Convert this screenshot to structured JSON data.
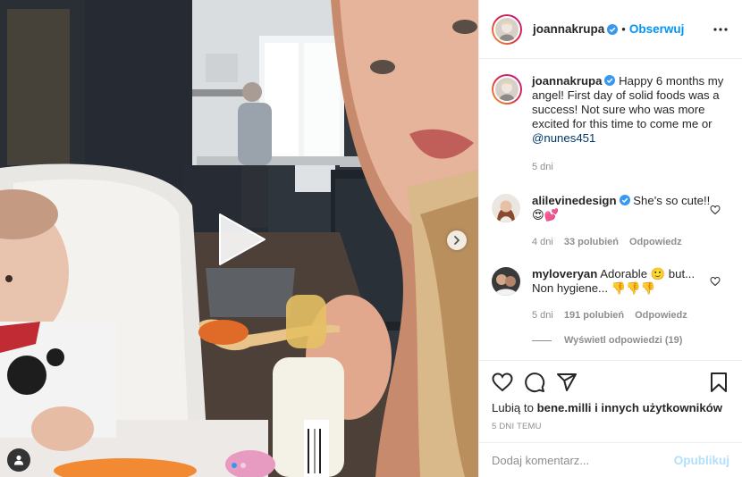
{
  "header": {
    "username": "joannakrupa",
    "separator": "•",
    "follow_label": "Obserwuj"
  },
  "caption": {
    "username": "joannakrupa",
    "text": "Happy 6 months my angel! First day of solid foods was a success! Not sure who was more excited for this time to come me or",
    "mention": "@nunes451",
    "age": "5 dni"
  },
  "comments": [
    {
      "username": "alilevinedesign",
      "text": "She's so cute!!😍💕",
      "age": "4 dni",
      "likes": "33 polubień",
      "reply_label": "Odpowiedz"
    },
    {
      "username": "myloveryan",
      "text": "Adorable 🙂 but... Non hygiene... 👎👎👎",
      "age": "5 dni",
      "likes": "191 polubień",
      "reply_label": "Odpowiedz",
      "view_replies": "Wyświetl odpowiedzi (19)"
    }
  ],
  "actions": {
    "likes_prefix": "Lubią to",
    "liked_by": "bene.milli",
    "likes_suffix": "i innych użytkowników",
    "time_ago": "5 DNI TEMU"
  },
  "composer": {
    "placeholder": "Dodaj komentarz...",
    "publish_label": "Opublikuj"
  },
  "colors": {
    "accent": "#0095f6",
    "publish_disabled": "#b2dffc",
    "muted": "#8e8e8e"
  },
  "carousel": {
    "slides": 2,
    "active": 1
  }
}
